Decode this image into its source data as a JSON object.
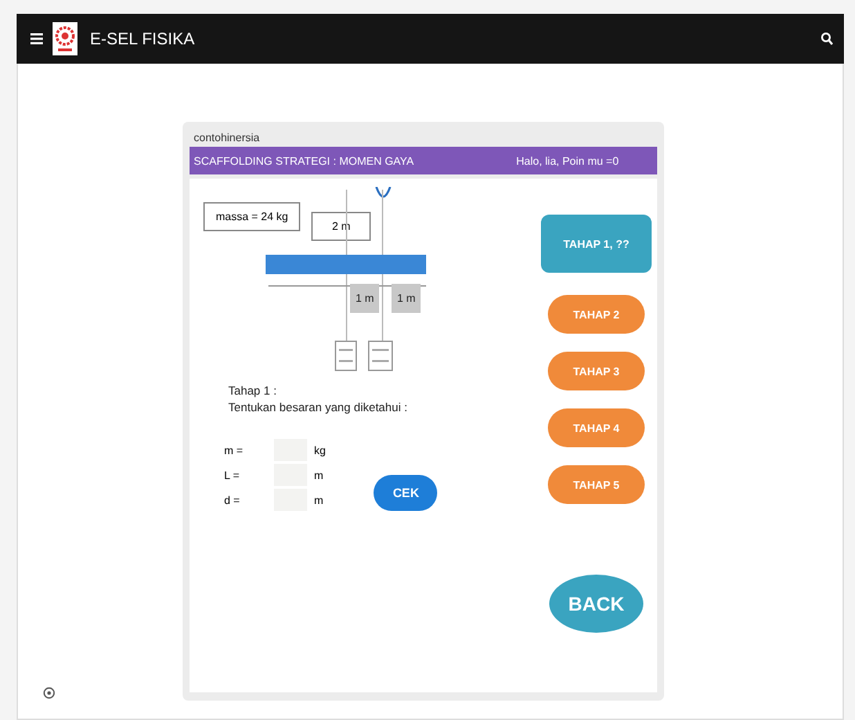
{
  "app_bar": {
    "title": "E-SEL FISIKA"
  },
  "card": {
    "user": "contohinersia",
    "banner_title": "SCAFFOLDING STRATEGI : MOMEN GAYA",
    "greeting": "Halo, lia, Poin mu =0"
  },
  "diagram": {
    "mass_label": "massa = 24 kg",
    "length_label": "2 m",
    "segments": [
      "1 m",
      "1 m"
    ]
  },
  "task": {
    "step": "Tahap 1 :",
    "instruction": "Tentukan besaran yang diketahui :"
  },
  "inputs": [
    {
      "label": "m =",
      "unit": "kg"
    },
    {
      "label": "L =",
      "unit": "m"
    },
    {
      "label": "d =",
      "unit": "m"
    }
  ],
  "check_button": "CEK",
  "stages": [
    {
      "label": "TAHAP 1, ??",
      "selected": true
    },
    {
      "label": "TAHAP 2",
      "selected": false
    },
    {
      "label": "TAHAP 3",
      "selected": false
    },
    {
      "label": "TAHAP 4",
      "selected": false
    },
    {
      "label": "TAHAP 5",
      "selected": false
    }
  ],
  "back_button": "BACK"
}
